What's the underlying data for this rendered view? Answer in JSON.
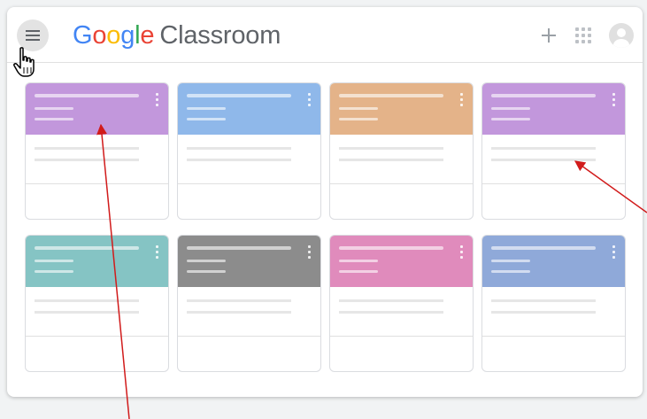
{
  "app": {
    "logo_letters": [
      {
        "ch": "G",
        "color": "#4285F4"
      },
      {
        "ch": "o",
        "color": "#EA4335"
      },
      {
        "ch": "o",
        "color": "#FBBC05"
      },
      {
        "ch": "g",
        "color": "#4285F4"
      },
      {
        "ch": "l",
        "color": "#34A853"
      },
      {
        "ch": "e",
        "color": "#EA4335"
      }
    ],
    "product": "Classroom"
  },
  "topbar": {
    "menu_icon": "hamburger-menu-icon",
    "actions": [
      "add-icon",
      "apps-grid-icon",
      "account-avatar-icon"
    ]
  },
  "cards": [
    {
      "color": "#c297dc"
    },
    {
      "color": "#8fb8ea"
    },
    {
      "color": "#e4b389"
    },
    {
      "color": "#c297dc"
    },
    {
      "color": "#85c4c4"
    },
    {
      "color": "#8c8c8c"
    },
    {
      "color": "#e08bbc"
    },
    {
      "color": "#8fa9d9"
    }
  ],
  "annotation": {
    "arrow_color": "#d11b1b",
    "cursor_icon": "pointer-hand-icon"
  }
}
